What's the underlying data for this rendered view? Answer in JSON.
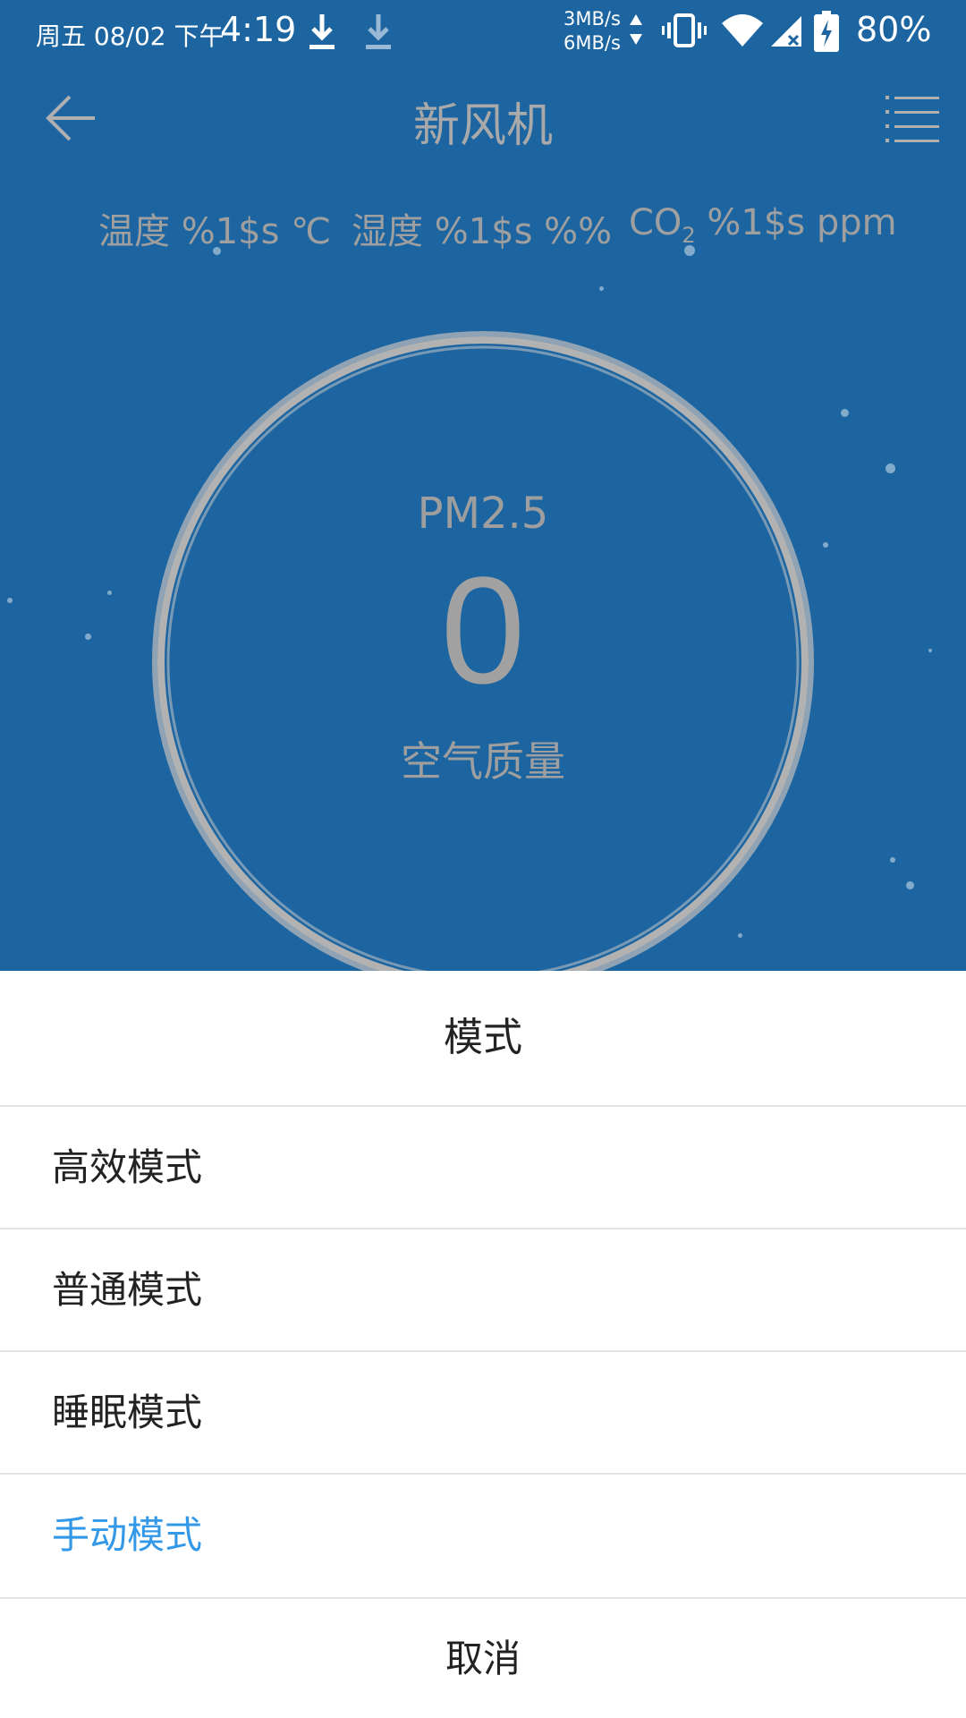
{
  "status_bar": {
    "date": "周五 08/02 下午",
    "time": "4:19",
    "net_up": "3MB/s",
    "net_down": "6MB/s",
    "battery_percent": "80%",
    "icons": [
      "download-icon",
      "download-icon",
      "network-speed-arrows-icon",
      "vibrate-icon",
      "wifi-icon",
      "signal-no-service-icon",
      "battery-charging-icon"
    ]
  },
  "header": {
    "title": "新风机",
    "back_icon": "arrow-left-icon",
    "menu_icon": "list-menu-icon"
  },
  "environment": {
    "temperature": "温度 %1$s ℃",
    "humidity": "湿度 %1$s %%",
    "co2_label": "CO",
    "co2_subscript": "2",
    "co2_value": " %1$s ppm"
  },
  "air": {
    "pm_label": "PM2.5",
    "pm_value": "0",
    "quality_label": "空气质量"
  },
  "sheet": {
    "title": "模式",
    "modes": [
      {
        "label": "高效模式",
        "selected": false
      },
      {
        "label": "普通模式",
        "selected": false
      },
      {
        "label": "睡眠模式",
        "selected": false
      },
      {
        "label": "手动模式",
        "selected": true
      }
    ],
    "cancel": "取消"
  },
  "colors": {
    "background": "#1d65a0",
    "accent": "#3398e7",
    "text_dim": "#a9a9a9"
  }
}
